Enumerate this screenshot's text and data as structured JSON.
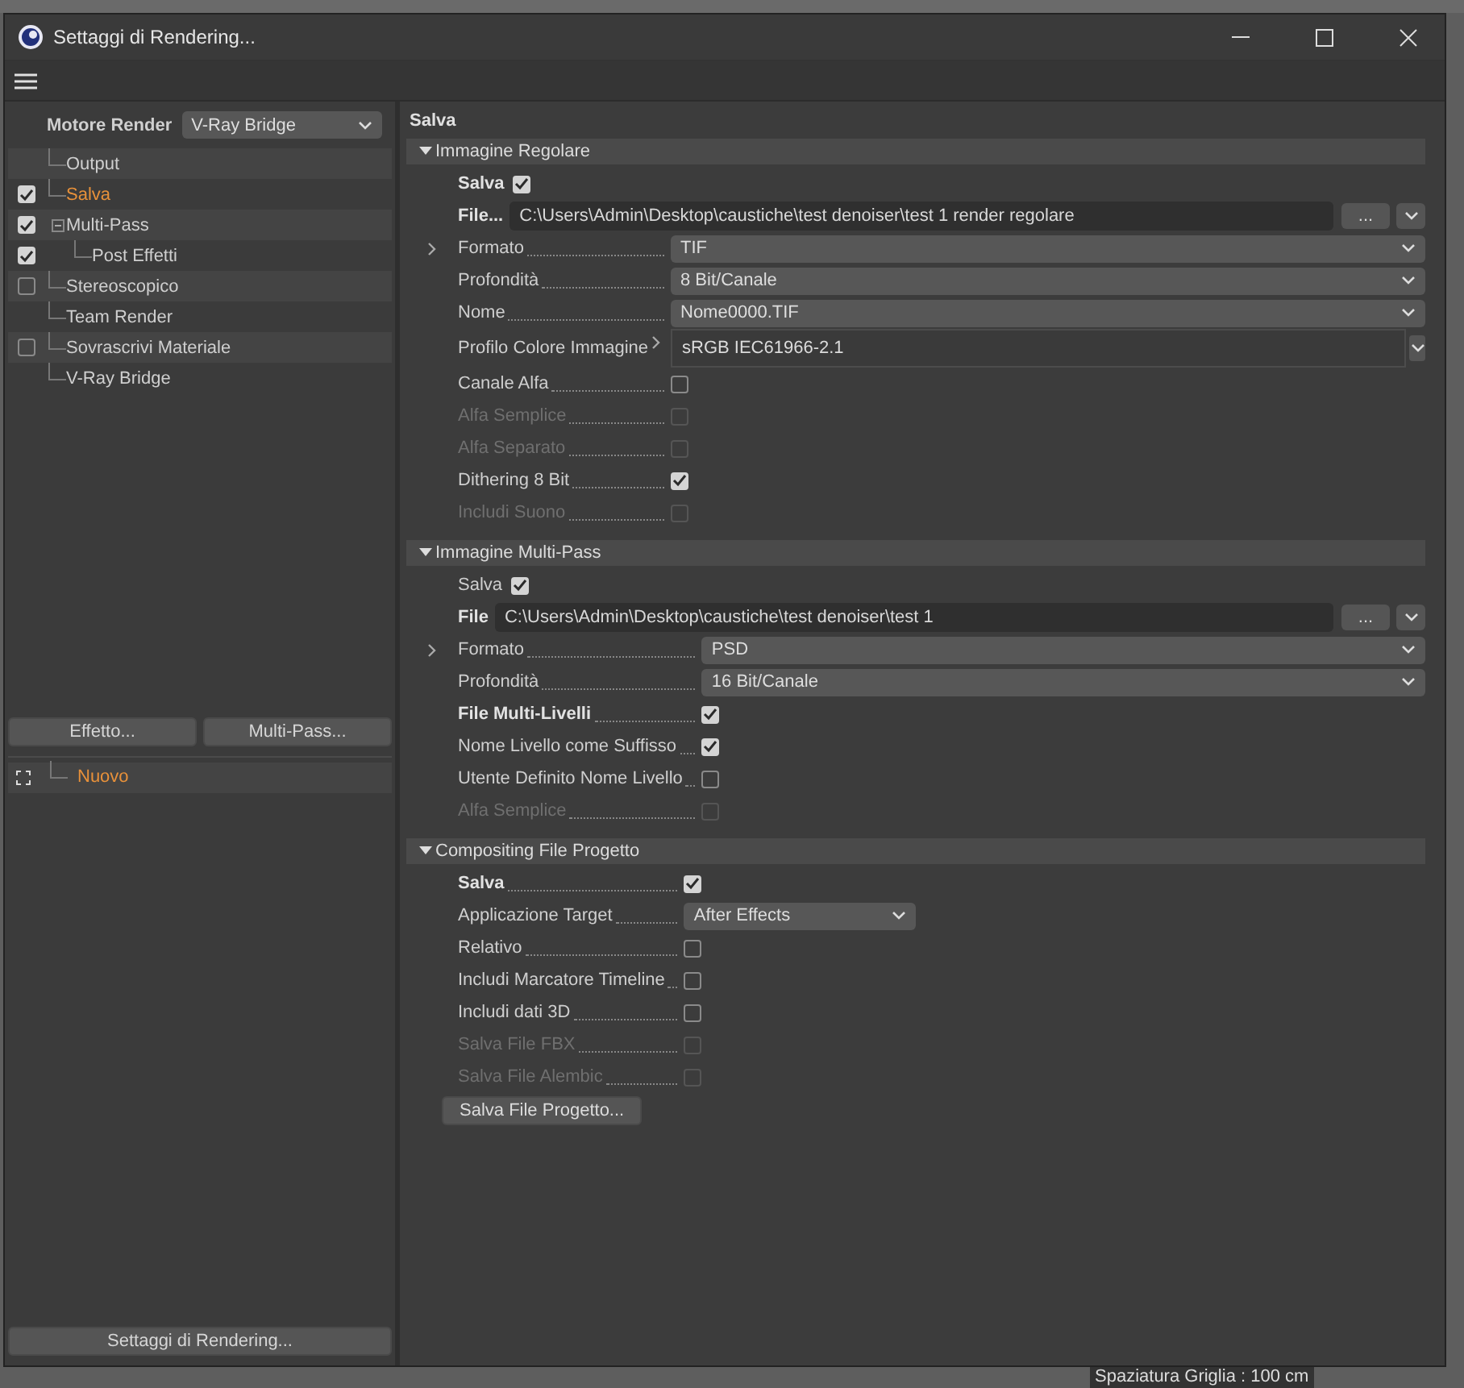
{
  "window": {
    "title": "Settaggi di Rendering..."
  },
  "left_panel": {
    "engine_label": "Motore Render",
    "engine_value": "V-Ray Bridge",
    "tree": [
      {
        "label": "Output",
        "selected": false
      },
      {
        "label": "Salva",
        "checked": true,
        "selected": true
      },
      {
        "label": "Multi-Pass",
        "checked": true,
        "selected": false,
        "expanded": true,
        "children": [
          {
            "label": "Post Effetti",
            "checked": true,
            "selected": false
          }
        ]
      },
      {
        "label": "Stereoscopico",
        "checked": false,
        "selected": false
      },
      {
        "label": "Team Render",
        "selected": false
      },
      {
        "label": "Sovrascrivi Materiale",
        "checked": false,
        "selected": false
      },
      {
        "label": "V-Ray Bridge",
        "selected": false
      }
    ],
    "buttons": [
      "Effetto...",
      "Multi-Pass..."
    ],
    "effects": [
      {
        "label": "Nuovo",
        "selected": true
      }
    ],
    "bottom_button": "Settaggi di Rendering..."
  },
  "main": {
    "title": "Salva",
    "sections": [
      {
        "title": "Immagine Regolare",
        "expanded": true,
        "rows": [
          {
            "kind": "inline_check",
            "label": "Salva",
            "bold": true,
            "checked": true
          },
          {
            "kind": "file",
            "label": "File...",
            "value": "C:\\Users\\Admin\\Desktop\\caustiche\\test denoiser\\test 1 render regolare",
            "button": "..."
          },
          {
            "kind": "select",
            "label": "Formato",
            "expander": true,
            "value": "TIF"
          },
          {
            "kind": "select",
            "label": "Profondità",
            "value": "8 Bit/Canale"
          },
          {
            "kind": "select",
            "label": "Nome",
            "value": "Nome0000.TIF"
          },
          {
            "kind": "profile",
            "label": "Profilo Colore Immagine",
            "value": "sRGB IEC61966-2.1"
          },
          {
            "kind": "check",
            "label": "Canale Alfa",
            "disabled": false,
            "checked": false
          },
          {
            "kind": "check",
            "label": "Alfa Semplice",
            "disabled": true,
            "checked": false
          },
          {
            "kind": "check",
            "label": "Alfa Separato",
            "disabled": true,
            "checked": false
          },
          {
            "kind": "check",
            "label": "Dithering 8 Bit",
            "disabled": false,
            "checked": true
          },
          {
            "kind": "check",
            "label": "Includi Suono",
            "disabled": true,
            "checked": false
          }
        ]
      },
      {
        "title": "Immagine Multi-Pass",
        "expanded": true,
        "rows": [
          {
            "kind": "inline_check",
            "label": "Salva",
            "bold": false,
            "checked": true
          },
          {
            "kind": "file",
            "label": "File",
            "value": "C:\\Users\\Admin\\Desktop\\caustiche\\test denoiser\\test 1",
            "button": "..."
          },
          {
            "kind": "select",
            "label": "Formato",
            "expander": true,
            "value": "PSD"
          },
          {
            "kind": "select",
            "label": "Profondità",
            "value": "16 Bit/Canale"
          },
          {
            "kind": "check",
            "label": "File Multi-Livelli",
            "bold": true,
            "disabled": false,
            "checked": true
          },
          {
            "kind": "check",
            "label": "Nome Livello come Suffisso",
            "disabled": false,
            "checked": true
          },
          {
            "kind": "check",
            "label": "Utente Definito Nome Livello",
            "disabled": false,
            "checked": false
          },
          {
            "kind": "check",
            "label": "Alfa Semplice",
            "disabled": true,
            "checked": false
          }
        ]
      },
      {
        "title": "Compositing File Progetto",
        "expanded": true,
        "rows": [
          {
            "kind": "check",
            "label": "Salva",
            "bold": true,
            "disabled": false,
            "checked": true
          },
          {
            "kind": "short_select",
            "label": "Applicazione Target",
            "value": "After Effects"
          },
          {
            "kind": "check",
            "label": "Relativo",
            "disabled": false,
            "checked": false
          },
          {
            "kind": "check",
            "label": "Includi Marcatore Timeline",
            "disabled": false,
            "checked": false
          },
          {
            "kind": "check",
            "label": "Includi dati 3D",
            "disabled": false,
            "checked": false
          },
          {
            "kind": "check",
            "label": "Salva File FBX",
            "disabled": true,
            "checked": false
          },
          {
            "kind": "check",
            "label": "Salva File Alembic",
            "disabled": true,
            "checked": false
          },
          {
            "kind": "button",
            "label": "Salva File Progetto..."
          }
        ]
      }
    ]
  },
  "background": {
    "status_text": "Spaziatura Griglia : 100 cm"
  }
}
